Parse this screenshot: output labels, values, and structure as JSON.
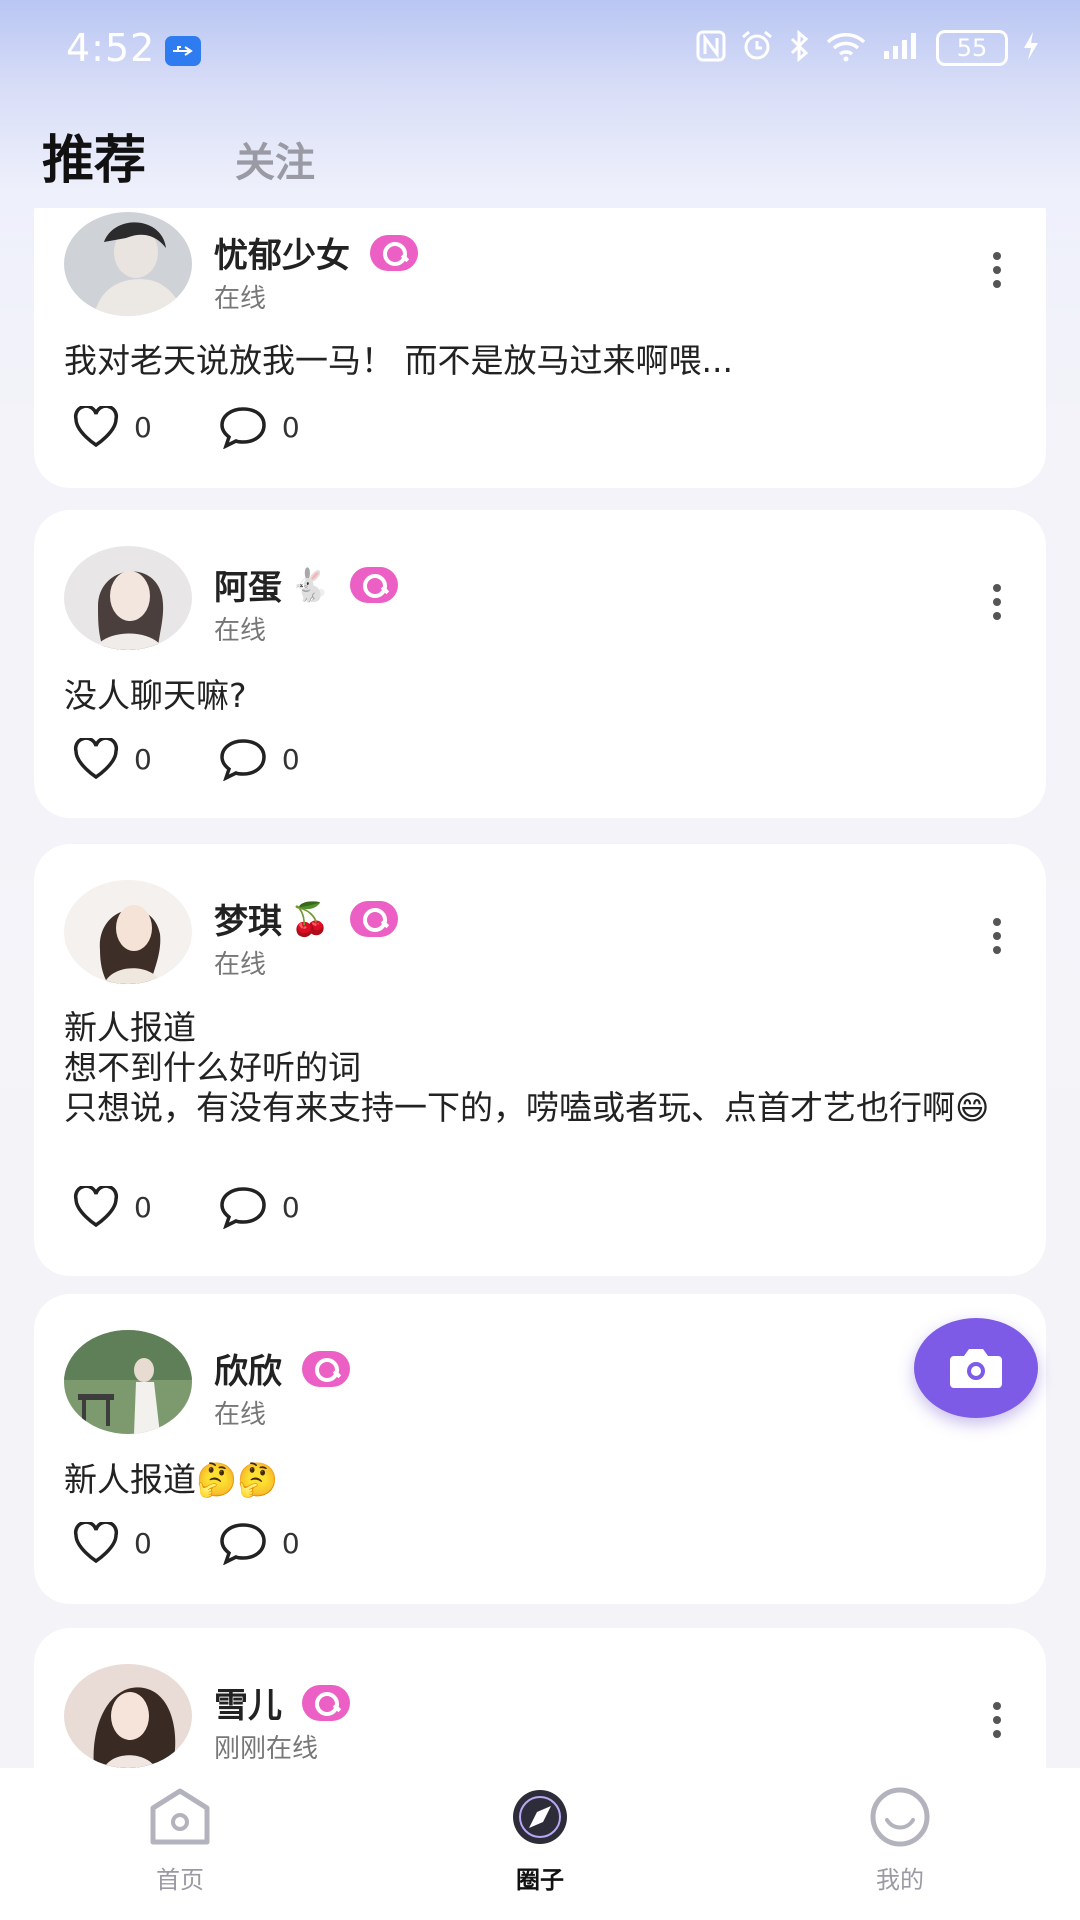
{
  "status_bar": {
    "time": "4:52",
    "battery": "55",
    "icons": [
      "usb-icon",
      "nfc-icon",
      "alarm-icon",
      "bluetooth-icon",
      "wifi-icon",
      "signal-icon",
      "battery-icon",
      "charging-icon"
    ]
  },
  "tabs": [
    {
      "label": "推荐",
      "active": true
    },
    {
      "label": "关注",
      "active": false
    }
  ],
  "posts": [
    {
      "username": "忧郁少女",
      "emoji": "",
      "status": "在线",
      "text": "我对老天说放我一马！ 而不是放马过来啊喂...",
      "likes": "0",
      "comments": "0"
    },
    {
      "username": "阿蛋",
      "emoji": "🐇",
      "status": "在线",
      "text": "没人聊天嘛?",
      "likes": "0",
      "comments": "0"
    },
    {
      "username": "梦琪",
      "emoji": "🍒",
      "status": "在线",
      "text": "新人报道\n想不到什么好听的词\n只想说，有没有来支持一下的，唠嗑或者玩、点首才艺也行啊😄",
      "likes": "0",
      "comments": "0"
    },
    {
      "username": "欣欣",
      "emoji": "",
      "status": "在线",
      "text": "新人报道🤔🤔",
      "likes": "0",
      "comments": "0"
    },
    {
      "username": "雪儿",
      "emoji": "",
      "status": "刚刚在线",
      "text": "",
      "likes": "",
      "comments": ""
    }
  ],
  "fab": {
    "icon": "camera-icon"
  },
  "bottom_nav": [
    {
      "label": "首页",
      "icon": "home-icon",
      "active": false
    },
    {
      "label": "圈子",
      "icon": "compass-icon",
      "active": true
    },
    {
      "label": "我的",
      "icon": "smile-icon",
      "active": false
    }
  ],
  "colors": {
    "accent": "#7d5be6",
    "badge": "#ec5fc4",
    "active_text": "#111111",
    "inactive_text": "#9a9aa5"
  }
}
